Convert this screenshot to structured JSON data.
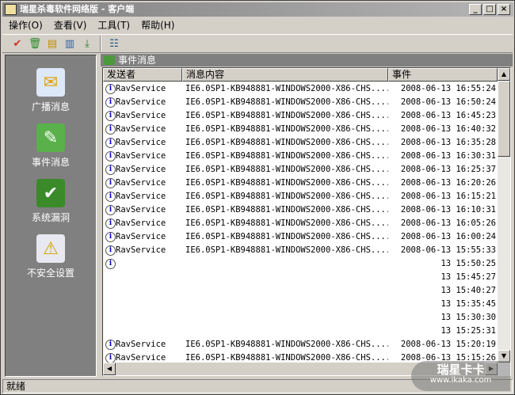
{
  "window": {
    "title": "瑞星杀毒软件网络版 - 客户端",
    "minimize": "_",
    "maximize": "□",
    "close": "×"
  },
  "menu": [
    "操作(O)",
    "查看(V)",
    "工具(T)",
    "帮助(H)"
  ],
  "toolbar": [
    "scan-icon",
    "delete-icon",
    "report-icon",
    "clear-report-icon",
    "download-icon",
    "settings-icon"
  ],
  "sidebar": [
    {
      "label": "广播消息",
      "icon": "broadcast-icon"
    },
    {
      "label": "事件消息",
      "icon": "event-icon"
    },
    {
      "label": "系统漏洞",
      "icon": "vulnerability-icon"
    },
    {
      "label": "不安全设置",
      "icon": "unsafe-settings-icon"
    }
  ],
  "panel": {
    "title": "事件消息",
    "columns": [
      "发送者",
      "消息内容",
      "事件"
    ]
  },
  "rows": [
    {
      "icon": true,
      "sender": "RavService",
      "content": "IE6.0SP1-KB948881-WINDOWS2000-X86-CHS....",
      "time": "2008-06-13 16:55:24"
    },
    {
      "icon": true,
      "sender": "RavService",
      "content": "IE6.0SP1-KB948881-WINDOWS2000-X86-CHS....",
      "time": "2008-06-13 16:50:24"
    },
    {
      "icon": true,
      "sender": "RavService",
      "content": "IE6.0SP1-KB948881-WINDOWS2000-X86-CHS....",
      "time": "2008-06-13 16:45:23"
    },
    {
      "icon": true,
      "sender": "RavService",
      "content": "IE6.0SP1-KB948881-WINDOWS2000-X86-CHS....",
      "time": "2008-06-13 16:40:32"
    },
    {
      "icon": true,
      "sender": "RavService",
      "content": "IE6.0SP1-KB948881-WINDOWS2000-X86-CHS....",
      "time": "2008-06-13 16:35:28"
    },
    {
      "icon": true,
      "sender": "RavService",
      "content": "IE6.0SP1-KB948881-WINDOWS2000-X86-CHS....",
      "time": "2008-06-13 16:30:31"
    },
    {
      "icon": true,
      "sender": "RavService",
      "content": "IE6.0SP1-KB948881-WINDOWS2000-X86-CHS....",
      "time": "2008-06-13 16:25:37"
    },
    {
      "icon": true,
      "sender": "RavService",
      "content": "IE6.0SP1-KB948881-WINDOWS2000-X86-CHS....",
      "time": "2008-06-13 16:20:26"
    },
    {
      "icon": true,
      "sender": "RavService",
      "content": "IE6.0SP1-KB948881-WINDOWS2000-X86-CHS....",
      "time": "2008-06-13 16:15:21"
    },
    {
      "icon": true,
      "sender": "RavService",
      "content": "IE6.0SP1-KB948881-WINDOWS2000-X86-CHS....",
      "time": "2008-06-13 16:10:31"
    },
    {
      "icon": true,
      "sender": "RavService",
      "content": "IE6.0SP1-KB948881-WINDOWS2000-X86-CHS....",
      "time": "2008-06-13 16:05:26"
    },
    {
      "icon": true,
      "sender": "RavService",
      "content": "IE6.0SP1-KB948881-WINDOWS2000-X86-CHS....",
      "time": "2008-06-13 16:00:24"
    },
    {
      "icon": true,
      "sender": "RavService",
      "content": "IE6.0SP1-KB948881-WINDOWS2000-X86-CHS....",
      "time": "2008-06-13 15:55:33"
    },
    {
      "icon": true,
      "sender": "",
      "content": "",
      "time": "13 15:50:25"
    },
    {
      "icon": false,
      "sender": "",
      "content": "",
      "time": "13 15:45:27"
    },
    {
      "icon": false,
      "sender": "",
      "content": "",
      "time": "13 15:40:27"
    },
    {
      "icon": false,
      "sender": "",
      "content": "",
      "time": "13 15:35:45"
    },
    {
      "icon": false,
      "sender": "",
      "content": "",
      "time": "13 15:30:30"
    },
    {
      "icon": false,
      "sender": "",
      "content": "",
      "time": "13 15:25:31"
    },
    {
      "icon": true,
      "sender": "RavService",
      "content": "IE6.0SP1-KB948881-WINDOWS2000-X86-CHS....",
      "time": "2008-06-13 15:20:19"
    },
    {
      "icon": true,
      "sender": "RavService",
      "content": "IE6.0SP1-KB948881-WINDOWS2000-X86-CHS....",
      "time": "2008-06-13 15:15:26"
    }
  ],
  "status": "就绪",
  "watermark": {
    "brand": "瑞星卡卡",
    "url": "www.ikaka.com"
  }
}
